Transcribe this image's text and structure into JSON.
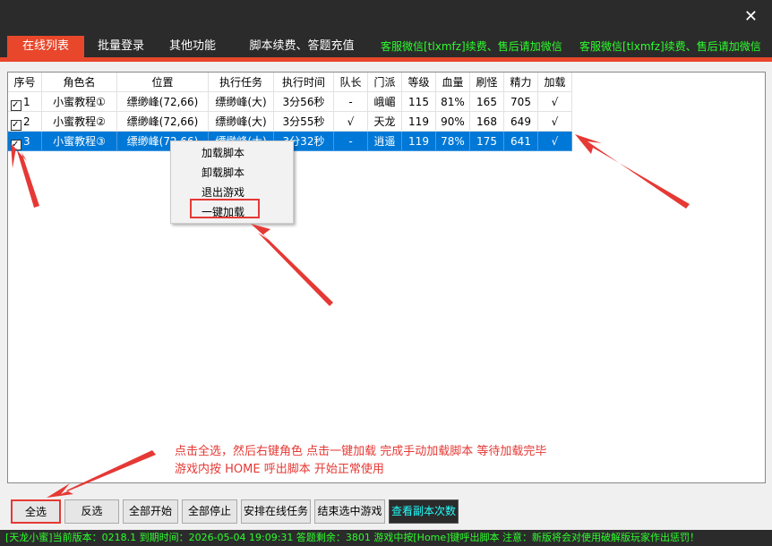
{
  "window": {
    "close": "✕"
  },
  "tabs": [
    {
      "label": "在线列表"
    },
    {
      "label": "批量登录"
    },
    {
      "label": "其他功能"
    },
    {
      "label": "脚本续费、答题充值"
    }
  ],
  "notices": [
    "客服微信[tlxmfz]续费、售后请加微信",
    "客服微信[tlxmfz]续费、售后请加微信"
  ],
  "table": {
    "headers": [
      "序号",
      "角色名",
      "位置",
      "执行任务",
      "执行时间",
      "队长",
      "门派",
      "等级",
      "血量",
      "刷怪",
      "精力",
      "加载"
    ],
    "rows": [
      [
        "1",
        "小蜜教程①",
        "缥缈峰(72,66)",
        "缥缈峰(大)",
        "3分56秒",
        "-",
        "峨嵋",
        "115",
        "81%",
        "165",
        "705",
        "√"
      ],
      [
        "2",
        "小蜜教程②",
        "缥缈峰(72,66)",
        "缥缈峰(大)",
        "3分55秒",
        "√",
        "天龙",
        "119",
        "90%",
        "168",
        "649",
        "√"
      ],
      [
        "3",
        "小蜜教程③",
        "缥缈峰(72,66)",
        "缥缈峰(大)",
        "3分32秒",
        "-",
        "逍遥",
        "119",
        "78%",
        "175",
        "641",
        "√"
      ]
    ],
    "checked": [
      true,
      true,
      true
    ],
    "selected_row": 3
  },
  "context_menu": [
    "加载脚本",
    "卸载脚本",
    "退出游戏",
    "一键加载"
  ],
  "annotation": [
    "点击全选，然后右键角色 点击一键加载 完成手动加载脚本 等待加载完毕",
    "游戏内按 HOME 呼出脚本 开始正常使用"
  ],
  "buttons": [
    "全选",
    "反选",
    "全部开始",
    "全部停止",
    "安排在线任务",
    "结束选中游戏",
    "查看副本次数"
  ],
  "status": "[天龙小蜜]当前版本：0218.1  到期时间：2026-05-04 19:09:31  答题剩余：3801  游戏中按[Home]键呼出脚本  注意：新版将会对使用破解版玩家作出惩罚！",
  "colors": {
    "accent": "#e8472b",
    "green": "#2dfd2d",
    "selection": "#0078d7",
    "annotation": "#e53935"
  }
}
